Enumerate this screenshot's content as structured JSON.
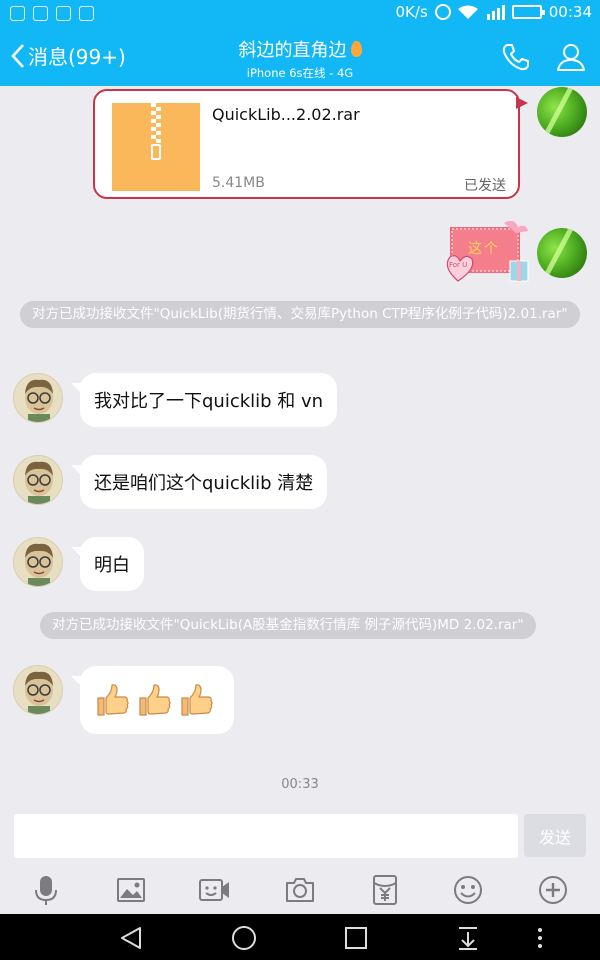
{
  "status_bar": {
    "speed": "0K/s",
    "network": "4G",
    "time": "00:34"
  },
  "header": {
    "back_label": "消息(99+)",
    "title": "斜边的直角边",
    "subtitle": "iPhone 6s在线 - 4G",
    "accent": "#12b7f5"
  },
  "file_message": {
    "name": "QuickLib...2.02.rar",
    "size": "5.41MB",
    "status": "已发送",
    "icon": "zip-archive-icon"
  },
  "sticker": {
    "text": "这个",
    "tag": "For U"
  },
  "messages": {
    "sys1": "对方已成功接收文件\"QuickLib(期货行情、交易库Python CTP程序化例子代码)2.01.rar\"",
    "m1": "我对比了一下quicklib 和 vn",
    "m2": "还是咱们这个quicklib 清楚",
    "m3": "明白",
    "sys2": "对方已成功接收文件\"QuickLib(A股基金指数行情库 例子源代码)MD 2.02.rar\"",
    "m4_emoji": "thumbs-up-icon x3",
    "time": "00:33"
  },
  "input": {
    "value": "",
    "send_label": "发送"
  },
  "toolbar": [
    "microphone-icon",
    "image-icon",
    "video-call-icon",
    "camera-icon",
    "red-packet-icon",
    "emoji-icon",
    "plus-icon"
  ],
  "nav": [
    "back-triangle-icon",
    "home-circle-icon",
    "recents-square-icon",
    "notification-pull-icon",
    "more-dots-icon"
  ]
}
